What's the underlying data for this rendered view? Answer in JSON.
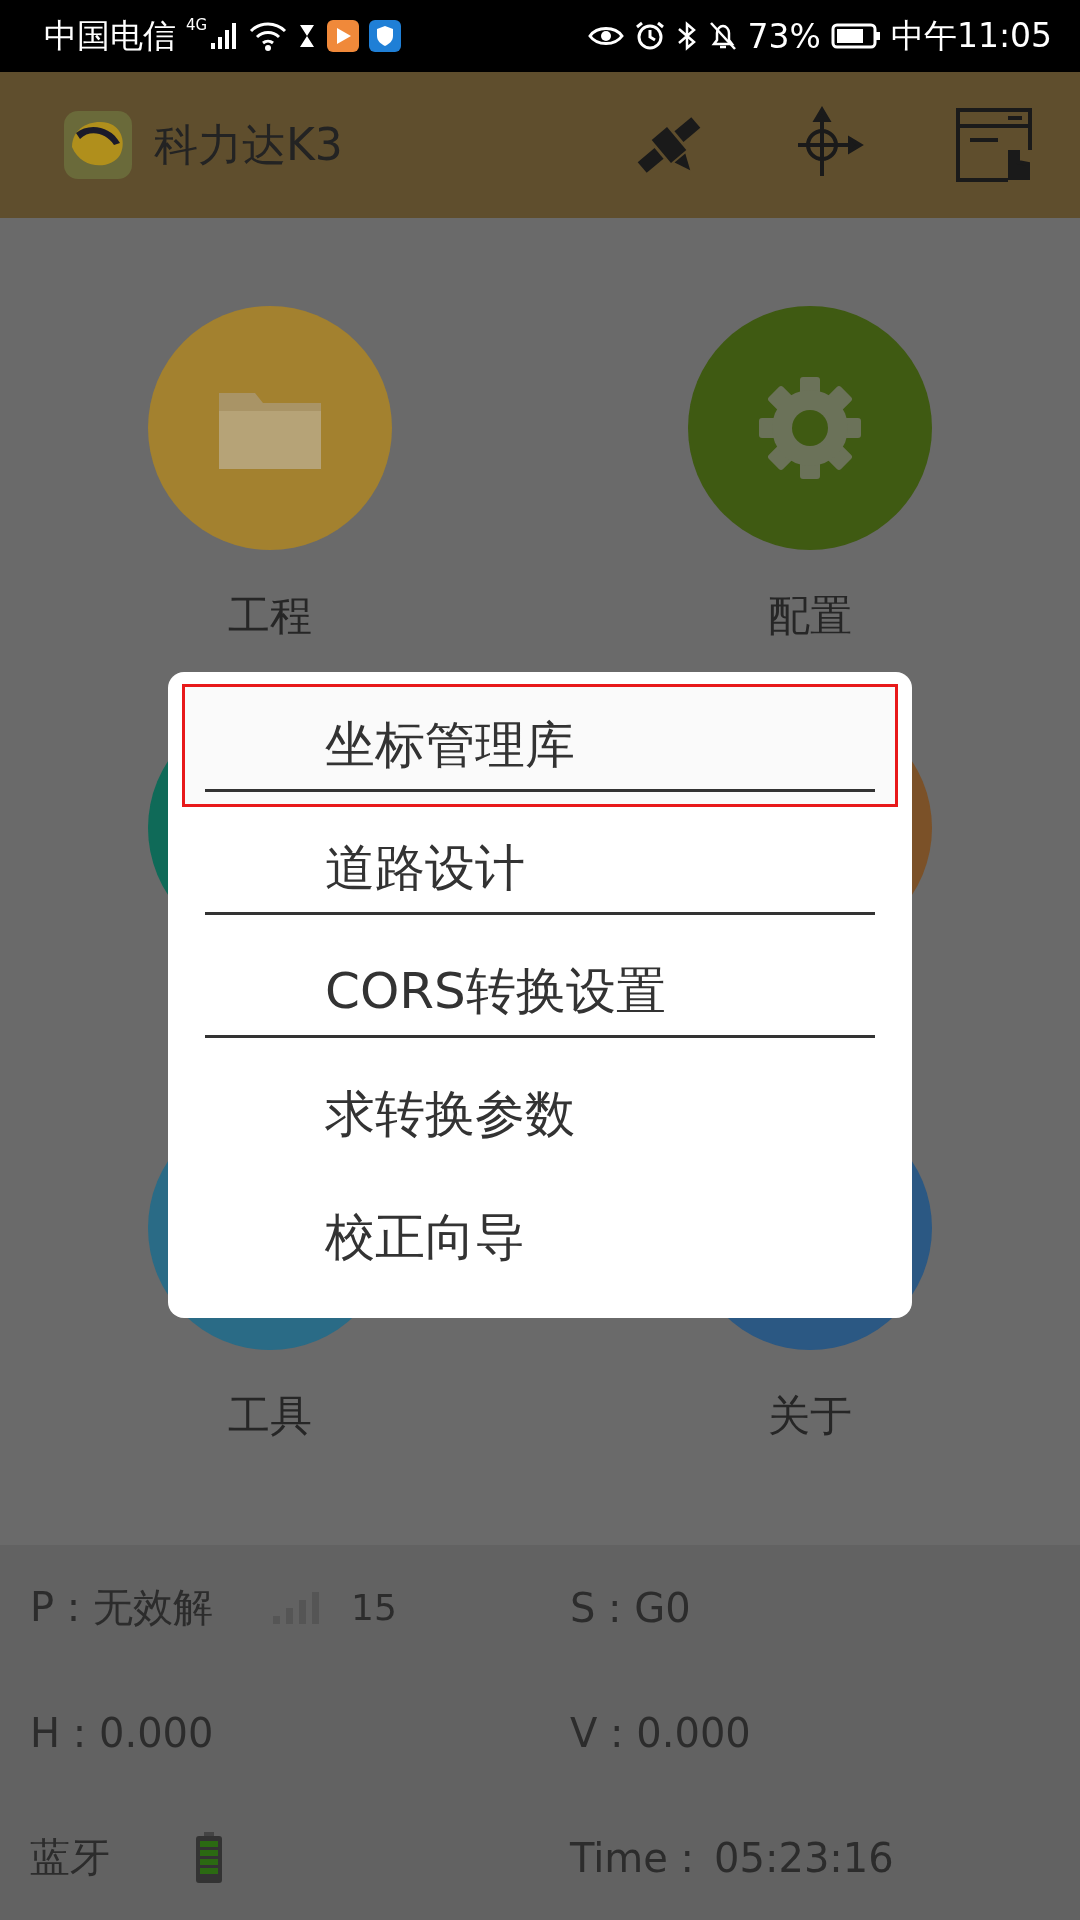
{
  "status_bar": {
    "carrier": "中国电信",
    "network": "4G",
    "battery": "73%",
    "time": "中午11:05"
  },
  "app_bar": {
    "title": "科力达K3"
  },
  "tiles": [
    {
      "label": "工程",
      "kind": "folder",
      "color": "#a3812f"
    },
    {
      "label": "配置",
      "kind": "gear",
      "color": "#3f5a12"
    },
    {
      "kind": "plain",
      "color": "#0f6a58"
    },
    {
      "kind": "plain",
      "color": "#7b5128"
    },
    {
      "label": "工具",
      "kind": "plain",
      "color": "#2a6b86"
    },
    {
      "label": "关于",
      "kind": "plain",
      "color": "#2b5883"
    }
  ],
  "menu": {
    "items": [
      {
        "label": "坐标管理库",
        "highlighted": true,
        "divider": true
      },
      {
        "label": "道路设计",
        "highlighted": false,
        "divider": true
      },
      {
        "label": "CORS转换设置",
        "highlighted": false,
        "divider": true
      },
      {
        "label": "求转换参数",
        "highlighted": false,
        "divider": false
      },
      {
        "label": "校正向导",
        "highlighted": false,
        "divider": false
      }
    ]
  },
  "info": {
    "p": "P : 无效解",
    "satellites": "15",
    "s": "S : G0",
    "h": "H : 0.000",
    "v": "V : 0.000",
    "bluetooth": "蓝牙",
    "time_label": "Time :",
    "time": "05:23:16"
  }
}
